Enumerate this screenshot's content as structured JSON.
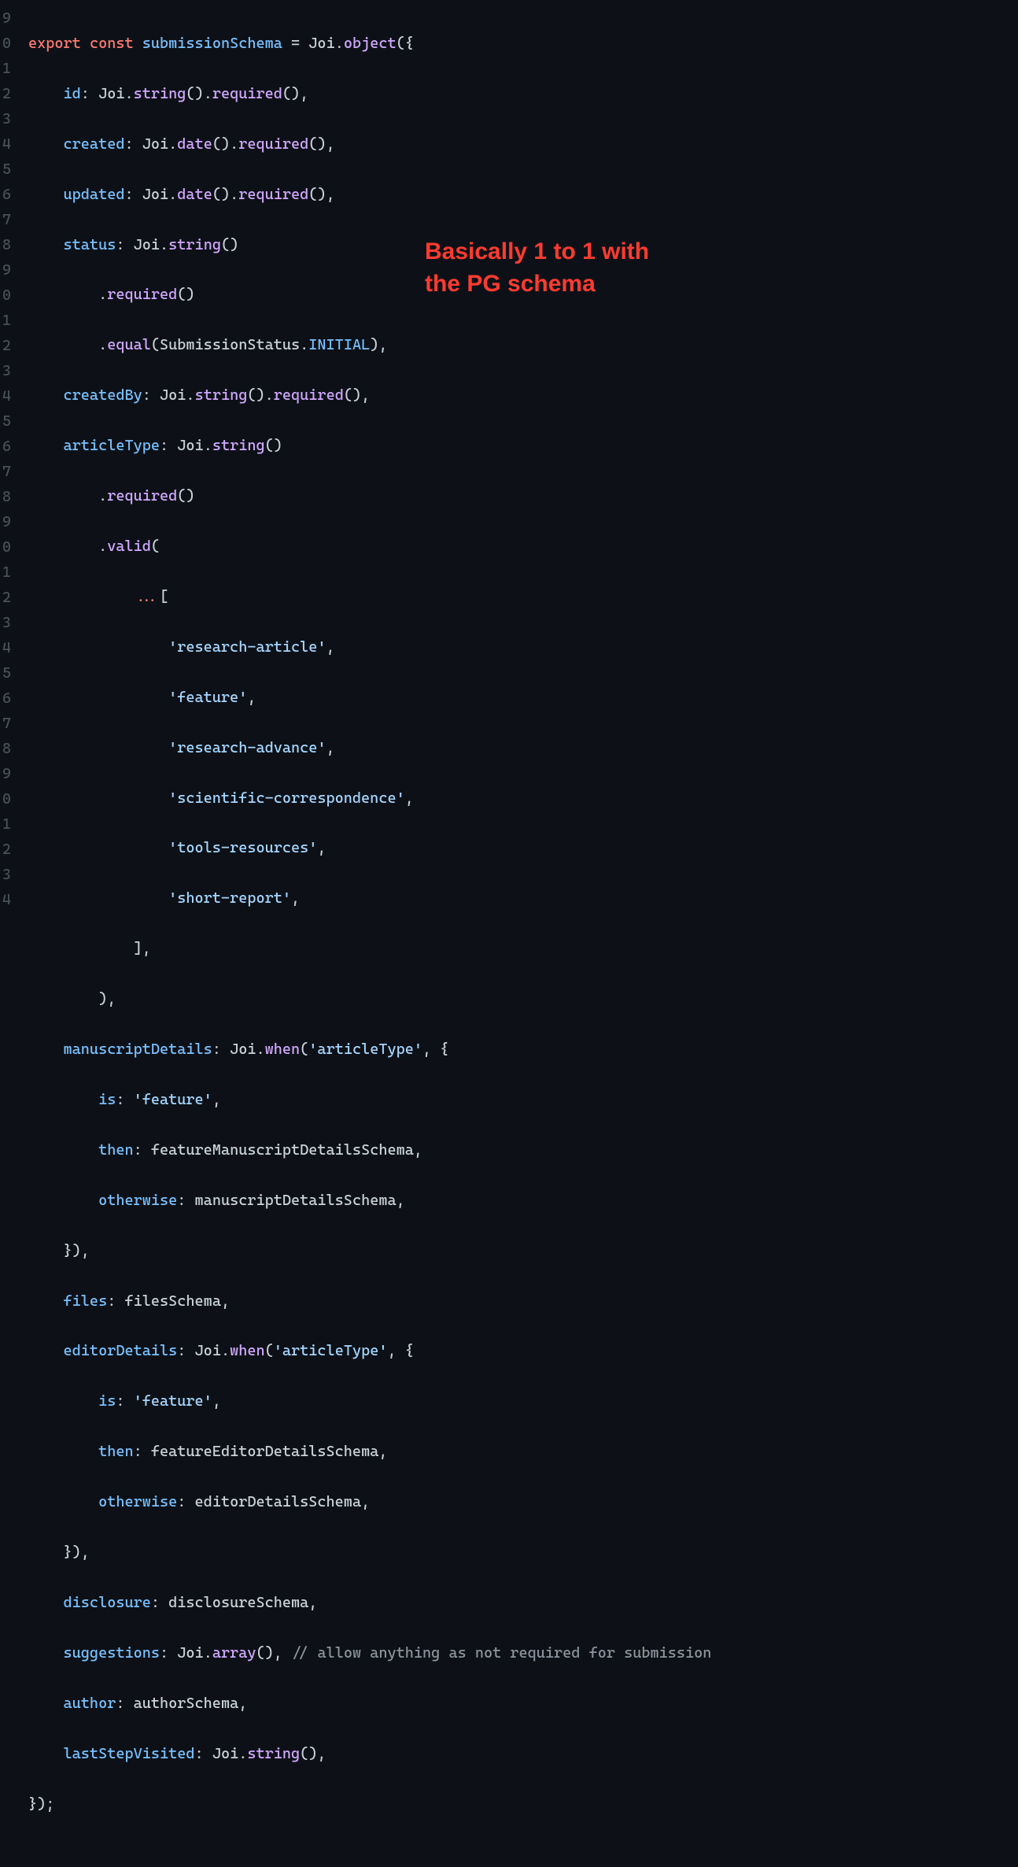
{
  "annotation": {
    "line1": "Basically 1 to 1 with",
    "line2": "the PG schema"
  },
  "gutter": [
    "9",
    "0",
    "1",
    "2",
    "3",
    "4",
    "5",
    "6",
    "7",
    "8",
    "9",
    "0",
    "1",
    "2",
    "3",
    "4",
    "5",
    "6",
    "7",
    "8",
    "9",
    "0",
    "1",
    "2",
    "3",
    "4",
    "5",
    "6",
    "7",
    "8",
    "9",
    "0",
    "1",
    "2",
    "3",
    "4"
  ],
  "tokens": {
    "export": "export",
    "const": "const",
    "submissionSchema": "submissionSchema",
    "Joi": "Joi",
    "object": "object",
    "id": "id",
    "string": "string",
    "required": "required",
    "created": "created",
    "date": "date",
    "updated": "updated",
    "status": "status",
    "equal": "equal",
    "SubmissionStatus": "SubmissionStatus",
    "INITIAL": "INITIAL",
    "createdBy": "createdBy",
    "articleType": "articleType",
    "valid": "valid",
    "researchArticle": "'research-article'",
    "feature": "'feature'",
    "researchAdvance": "'research-advance'",
    "scientificCorrespondence": "'scientific-correspondence'",
    "toolsResources": "'tools-resources'",
    "shortReport": "'short-report'",
    "manuscriptDetails": "manuscriptDetails",
    "when": "when",
    "articleTypeStr": "'articleType'",
    "is": "is",
    "featureStr": "'feature'",
    "then": "then",
    "featureManuscriptDetailsSchema": "featureManuscriptDetailsSchema",
    "otherwise": "otherwise",
    "manuscriptDetailsSchema": "manuscriptDetailsSchema",
    "files": "files",
    "filesSchema": "filesSchema",
    "editorDetails": "editorDetails",
    "featureEditorDetailsSchema": "featureEditorDetailsSchema",
    "editorDetailsSchema": "editorDetailsSchema",
    "disclosure": "disclosure",
    "disclosureSchema": "disclosureSchema",
    "suggestions": "suggestions",
    "array": "array",
    "comment": "// allow anything as not required for submission",
    "author": "author",
    "authorSchema": "authorSchema",
    "lastStepVisited": "lastStepVisited"
  }
}
